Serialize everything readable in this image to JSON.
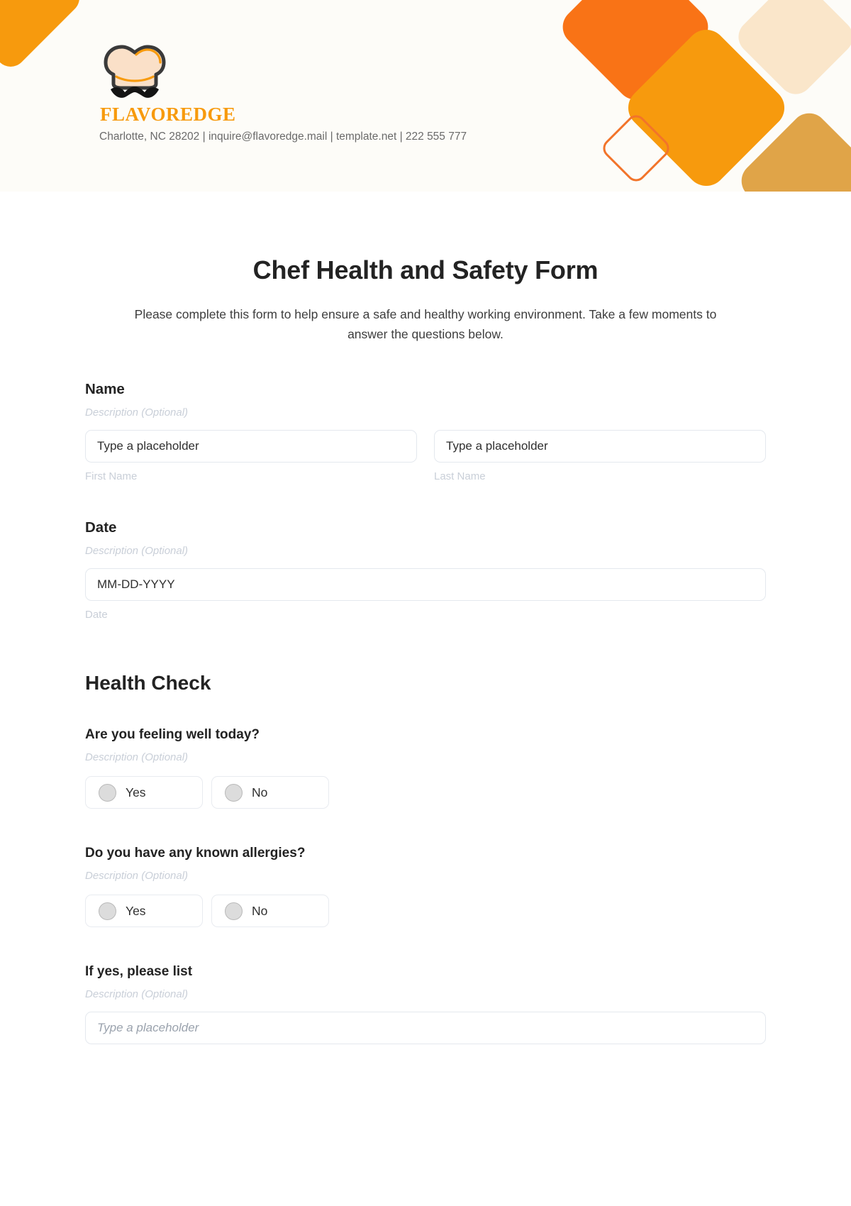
{
  "header": {
    "brand_name": "FLAVOREDGE",
    "contact": "Charlotte, NC 28202 | inquire@flavoredge.mail | template.net | 222 555 777",
    "logo_icon": "chef-hat-mustache-icon",
    "colors": {
      "background": "#fdfcf8",
      "brand_orange": "#f79a0d",
      "accent_orange_red": "#f97316",
      "accent_cream": "#fae6ca",
      "accent_tan": "#e0a448",
      "outline_orange": "#f2742a"
    }
  },
  "form": {
    "title": "Chef Health and Safety Form",
    "subtitle": "Please complete this form to help ensure a safe and healthy working environment. Take a few moments to answer the questions below.",
    "description_placeholder": "Description (Optional)",
    "name_field": {
      "label": "Name",
      "description": "Description (Optional)",
      "first": {
        "placeholder": "Type a placeholder",
        "sub_label": "First Name"
      },
      "last": {
        "placeholder": "Type a placeholder",
        "sub_label": "Last Name"
      }
    },
    "date_field": {
      "label": "Date",
      "description": "Description (Optional)",
      "placeholder": "MM-DD-YYYY",
      "sub_label": "Date"
    },
    "health_check": {
      "heading": "Health Check",
      "questions": [
        {
          "label": "Are you feeling well today?",
          "description": "Description (Optional)",
          "options": [
            "Yes",
            "No"
          ]
        },
        {
          "label": "Do you have any known allergies?",
          "description": "Description (Optional)",
          "options": [
            "Yes",
            "No"
          ]
        },
        {
          "label": "If yes, please list",
          "description": "Description (Optional)",
          "placeholder": "Type a placeholder"
        }
      ]
    }
  }
}
